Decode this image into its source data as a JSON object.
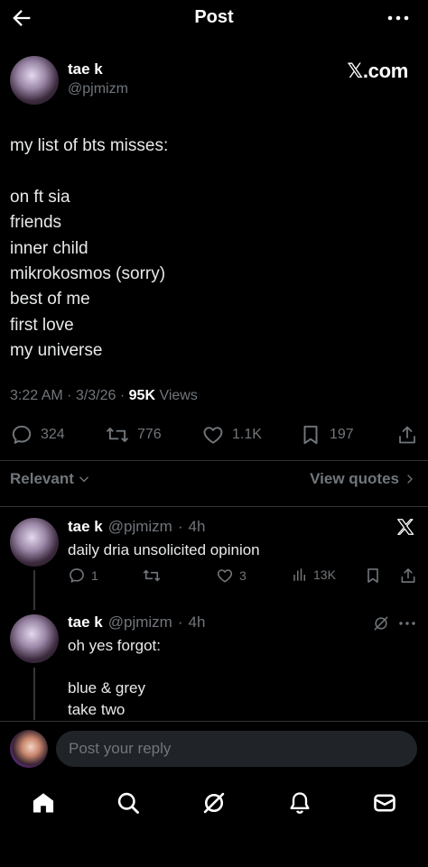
{
  "header": {
    "title": "Post"
  },
  "post": {
    "author_name": "tae k",
    "author_handle": "@pjmizm",
    "watermark": "𝕏.com",
    "body": "my list of bts misses:\n\non ft sia\nfriends\ninner child\nmikrokosmos (sorry)\nbest of me\nfirst love\nmy universe",
    "time": "3:22 AM",
    "date": "3/3/26",
    "views_count": "95K",
    "views_label": "Views",
    "replies": "324",
    "reposts": "776",
    "likes": "1.1K",
    "bookmarks": "197"
  },
  "sort": {
    "label": "Relevant",
    "view_quotes": "View quotes"
  },
  "replies": [
    {
      "name": "tae k",
      "handle": "@pjmizm",
      "age": "4h",
      "text": "daily dria unsolicited opinion",
      "replies": "1",
      "likes": "3",
      "views": "13K"
    },
    {
      "name": "tae k",
      "handle": "@pjmizm",
      "age": "4h",
      "text": "oh yes forgot:\n\nblue & grey\ntake two"
    }
  ],
  "composer": {
    "placeholder": "Post your reply"
  },
  "nav": [
    "home-icon",
    "search-icon",
    "grok-icon",
    "notifications-icon",
    "messages-icon"
  ],
  "colors": {
    "background": "#000000",
    "text": "#e7e9ea",
    "muted": "#71767b",
    "divider": "#2f3336",
    "input": "#202327"
  }
}
